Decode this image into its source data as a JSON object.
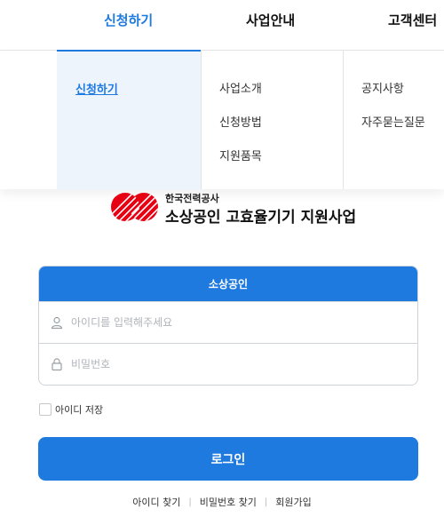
{
  "nav": {
    "tabs": [
      {
        "label": "신청하기"
      },
      {
        "label": "사업안내"
      },
      {
        "label": "고객센터"
      }
    ]
  },
  "mega": {
    "col1": [
      "신청하기"
    ],
    "col2": [
      "사업소개",
      "신청방법",
      "지원품목"
    ],
    "col3": [
      "공지사항",
      "자주묻는질문"
    ]
  },
  "logo": {
    "company": "한국전력공사",
    "title": "소상공인 고효율기기 지원사업"
  },
  "login": {
    "tab_label": "소상공인",
    "id_placeholder": "아이디를 입력해주세요",
    "pw_placeholder": "비밀번호",
    "save_id_label": "아이디 저장",
    "button_label": "로그인"
  },
  "links": {
    "find_id": "아이디 찾기",
    "find_pw": "비밀번호 찾기",
    "signup": "회원가입",
    "separator": "|"
  },
  "colors": {
    "accent": "#1f7ae0",
    "logo_red": "#e60012"
  },
  "icons": {
    "user": "user-icon",
    "lock": "lock-icon"
  }
}
